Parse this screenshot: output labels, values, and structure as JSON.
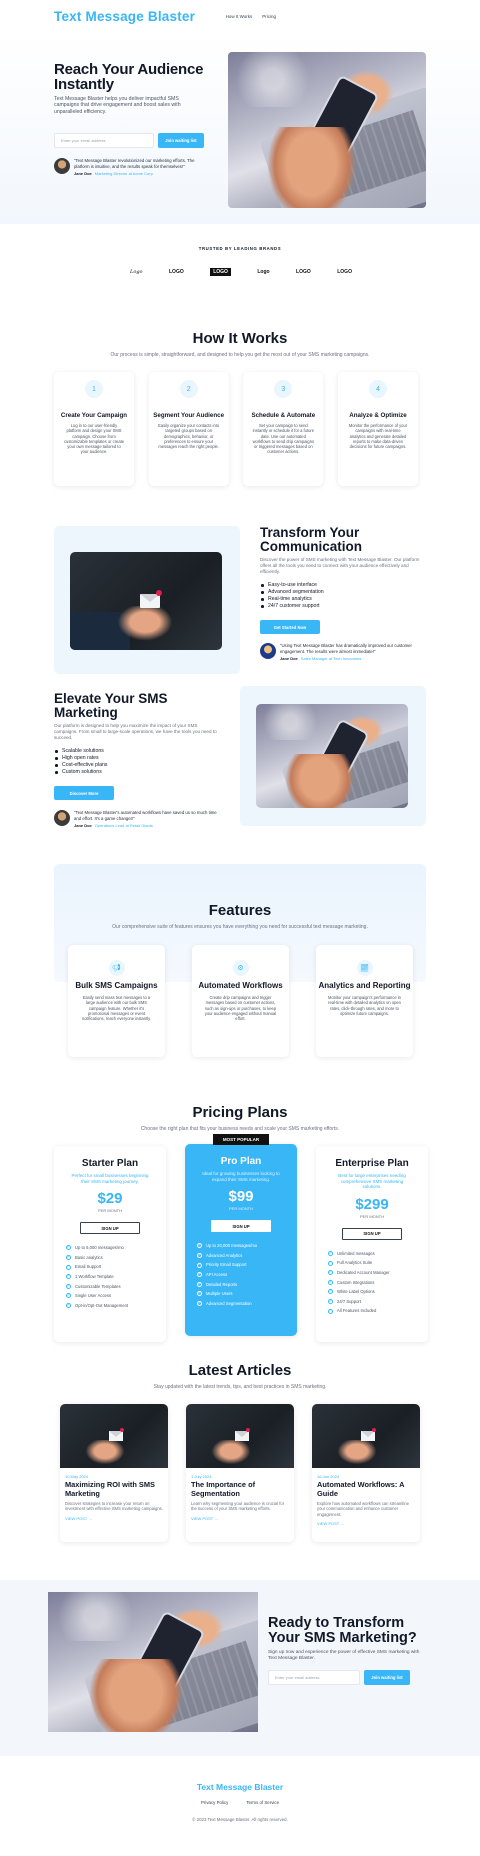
{
  "header": {
    "brand": "Text Message Blaster",
    "nav": [
      "How It Works",
      "Pricing"
    ]
  },
  "hero": {
    "title": "Reach Your Audience Instantly",
    "subtitle": "Text Message Blaster helps you deliver impactful SMS campaigns that drive engagement and boost sales with unparalleled efficiency.",
    "email_placeholder": "Enter your email address",
    "cta": "Join waiting list",
    "testimonial": {
      "quote": "Text Message Blaster revolutionized our marketing efforts. The platform is intuitive, and the results speak for themselves!",
      "name": "Jane Doe",
      "role": "Marketing Director at Acme Corp"
    }
  },
  "brands": {
    "title": "TRUSTED BY LEADING BRANDS",
    "logos": [
      "Logo",
      "LOGO",
      "LOGO",
      "Logo",
      "LOGO",
      "LOGO"
    ]
  },
  "how": {
    "title": "How It Works",
    "subtitle": "Our process is simple, straightforward, and designed to help you get the most out of your SMS marketing campaigns.",
    "steps": [
      {
        "num": "1",
        "title": "Create Your Campaign",
        "text": "Log in to our user-friendly platform and design your SMS campaign. Choose from customizable templates or create your own message tailored to your audience."
      },
      {
        "num": "2",
        "title": "Segment Your Audience",
        "text": "Easily organize your contacts into targeted groups based on demographics, behavior, or preferences to ensure your messages reach the right people."
      },
      {
        "num": "3",
        "title": "Schedule & Automate",
        "text": "Set your campaign to send instantly or schedule it for a future date. Use our automated workflows to send drip campaigns or triggered messages based on customer actions."
      },
      {
        "num": "4",
        "title": "Analyze & Optimize",
        "text": "Monitor the performance of your campaigns with real-time analytics and generate detailed reports to make data-driven decisions for future campaigns."
      }
    ]
  },
  "transform": {
    "title": "Transform Your Communication",
    "subtitle": "Discover the power of SMS marketing with Text Message Blaster. Our platform offers all the tools you need to connect with your audience effectively and efficiently.",
    "bullets": [
      "Easy-to-use interface",
      "Advanced segmentation",
      "Real-time analytics",
      "24/7 customer support"
    ],
    "cta": "Get Started Now",
    "testimonial": {
      "quote": "Using Text Message Blaster has dramatically improved our customer engagement. The results were almost immediate!",
      "name": "Jane Doe",
      "role": "Sales Manager at Tech Innovators"
    }
  },
  "elevate": {
    "title": "Elevate Your SMS Marketing",
    "subtitle": "Our platform is designed to help you maximize the impact of your SMS campaigns. From small to large-scale operations, we have the tools you need to succeed.",
    "bullets": [
      "Scalable solutions",
      "High open rates",
      "Cost-effective plans",
      "Custom solutions"
    ],
    "cta": "Discover More",
    "testimonial": {
      "quote": "Text Message Blaster's automated workflows have saved us so much time and effort. It's a game changer!",
      "name": "Jane Doe",
      "role": "Operations Lead at Retail Giants"
    }
  },
  "features": {
    "title": "Features",
    "subtitle": "Our comprehensive suite of features ensures you have everything you need for successful text message marketing.",
    "items": [
      {
        "icon": "megaphone-icon",
        "title": "Bulk SMS Campaigns",
        "text": "Easily send mass text messages to a large audience with our bulk SMS campaign feature. Whether it's promotional messages or event notifications, reach everyone instantly."
      },
      {
        "icon": "gears-icon",
        "title": "Automated Workflows",
        "text": "Create drip campaigns and trigger messages based on customer actions, such as sign-ups or purchases, to keep your audience engaged without manual effort."
      },
      {
        "icon": "chart-icon",
        "title": "Analytics and Reporting",
        "text": "Monitor your campaign's performance in real-time with detailed analytics on open rates, click-through rates, and more to optimize future campaigns."
      }
    ]
  },
  "pricing": {
    "title": "Pricing Plans",
    "subtitle": "Choose the right plan that fits your business needs and scale your SMS marketing efforts.",
    "badge": "MOST POPULAR",
    "plans": [
      {
        "name": "Starter Plan",
        "desc": "Perfect for small businesses beginning their SMS marketing journey.",
        "price": "$29",
        "per": "PER MONTH",
        "cta": "SIGN UP",
        "features": [
          "Up to 5,000 messages/mo",
          "Basic analytics",
          "Email Support",
          "1 Workflow Template",
          "Customizable Templates",
          "Single User Access",
          "Opt-in/Opt-Out Management"
        ]
      },
      {
        "name": "Pro Plan",
        "desc": "Ideal for growing businesses looking to expand their SMS marketing.",
        "price": "$99",
        "per": "PER MONTH",
        "cta": "SIGN UP",
        "features": [
          "Up to 20,000 messages/mo",
          "Advanced Analytics",
          "Priority Email Support",
          "API Access",
          "Detailed Reports",
          "Multiple Users",
          "Advanced Segmentation"
        ]
      },
      {
        "name": "Enterprise Plan",
        "desc": "Best for large enterprises needing comprehensive SMS marketing solutions.",
        "price": "$299",
        "per": "PER MONTH",
        "cta": "SIGN UP",
        "features": [
          "Unlimited messages",
          "Full Analytics Suite",
          "Dedicated Account Manager",
          "Custom Integrations",
          "White Label Options",
          "24/7 Support",
          "All Features Included"
        ]
      }
    ]
  },
  "articles": {
    "title": "Latest Articles",
    "subtitle": "Stay updated with the latest trends, tips, and best practices in SMS marketing.",
    "items": [
      {
        "date": "10 May 2024",
        "title": "Maximizing ROI with SMS Marketing",
        "text": "Discover strategies to increase your return on investment with effective SMS marketing campaigns.",
        "more": "VIEW POST →"
      },
      {
        "date": "1 July 2024",
        "title": "The Importance of Segmentation",
        "text": "Learn why segmenting your audience is crucial for the success of your SMS marketing efforts.",
        "more": "VIEW POST →"
      },
      {
        "date": "16 Jan 2024",
        "title": "Automated Workflows: A Guide",
        "text": "Explore how automated workflows can streamline your communication and enhance customer engagement.",
        "more": "VIEW POST →"
      }
    ]
  },
  "cta": {
    "title": "Ready to Transform Your SMS Marketing?",
    "subtitle": "Sign up now and experience the power of effective SMS marketing with Text Message Blaster.",
    "email_placeholder": "Enter your email address",
    "button": "Join waiting list"
  },
  "footer": {
    "brand": "Text Message Blaster",
    "links": [
      "Privacy Policy",
      "Terms of Service"
    ],
    "copyright": "© 2023 Text Message Blaster. All rights reserved."
  },
  "colors": {
    "accent": "#38b6f6",
    "text": "#111827",
    "muted": "#6b7280",
    "tint": "#eef6fd"
  }
}
